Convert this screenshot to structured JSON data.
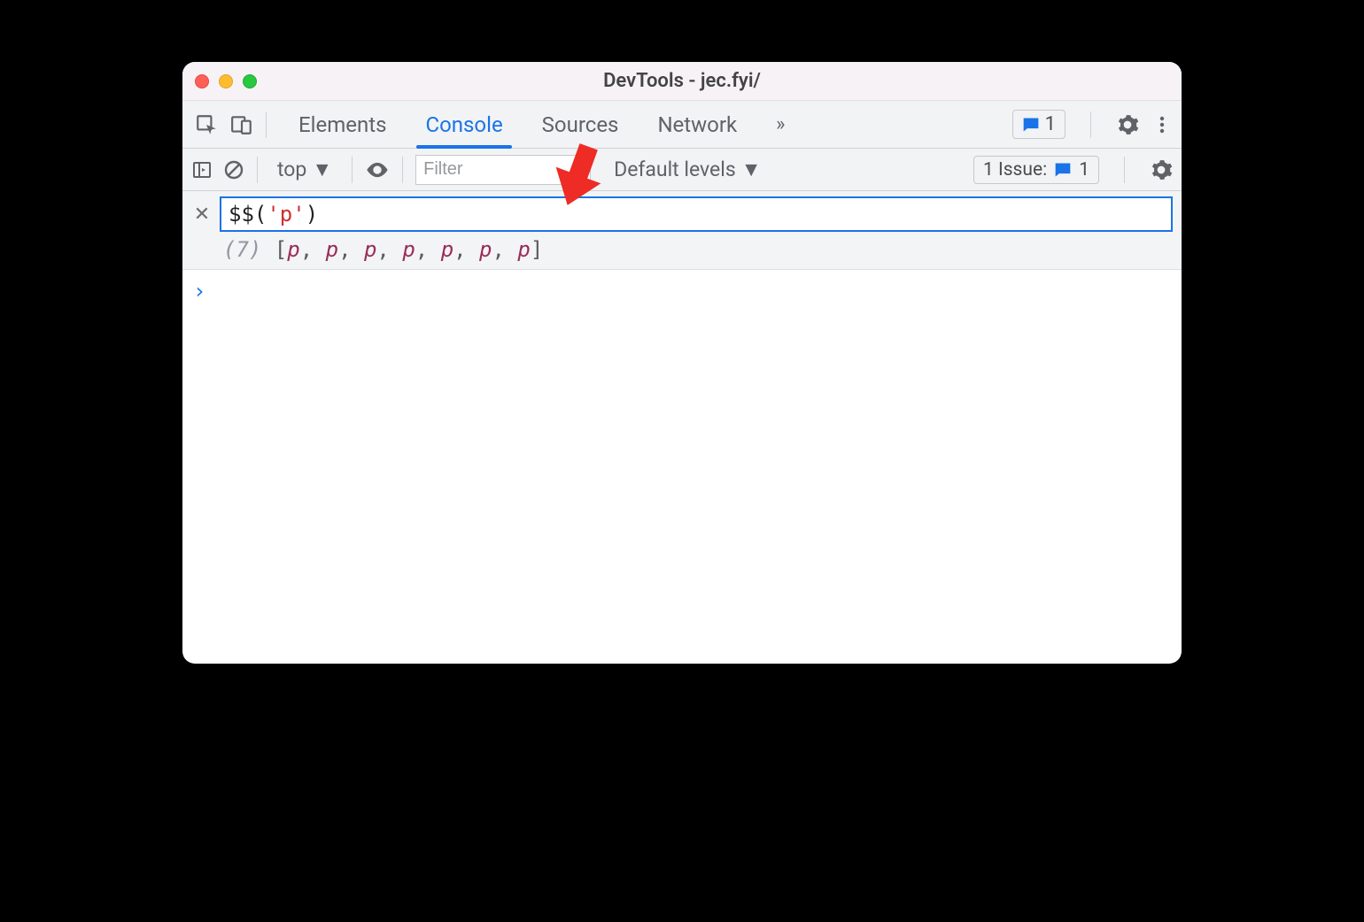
{
  "window": {
    "title": "DevTools - jec.fyi/"
  },
  "tabs": {
    "items": [
      "Elements",
      "Console",
      "Sources",
      "Network"
    ],
    "active_index": 1,
    "more_glyph": "»",
    "messages_count": "1"
  },
  "console_toolbar": {
    "context_label": "top",
    "filter_placeholder": "Filter",
    "levels_label": "Default levels",
    "issues_label_prefix": "1 Issue:",
    "issues_count": "1"
  },
  "eager_eval": {
    "expression_tokens": {
      "fn": "$$",
      "open": "(",
      "str": "'p'",
      "close": ")"
    },
    "result": {
      "count_text": "(7) ",
      "elements": [
        "p",
        "p",
        "p",
        "p",
        "p",
        "p",
        "p"
      ]
    }
  },
  "prompt_glyph": "›"
}
